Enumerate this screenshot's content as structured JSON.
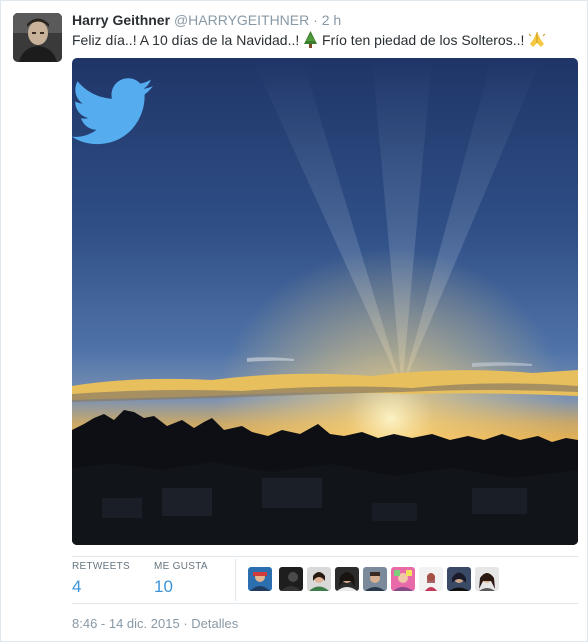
{
  "tweet": {
    "author_name": "Harry Geithner",
    "handle": "@HARRYGEITHNER",
    "separator": "·",
    "time_ago": "2 h",
    "text_part1": "Feliz día..! A 10 días de la Navidad..! ",
    "text_part2": "Frío ten piedad de los Solteros..! ",
    "emoji_1": "christmas-tree",
    "emoji_2": "folded-hands"
  },
  "media": {
    "description_icon": "twitter-bird-icon",
    "brand_color": "#55acee"
  },
  "stats": {
    "retweets_label": "RETWEETS",
    "retweets_count": "4",
    "likes_label": "ME GUSTA",
    "likes_count": "10",
    "liker_count_visible": 9
  },
  "footer": {
    "timestamp": "8:46 - 14 dic. 2015",
    "separator": "·",
    "details_label": "Detalles"
  },
  "colors": {
    "link_blue": "#3b94d9",
    "muted": "#8899a6",
    "text": "#292f33",
    "border": "#e1e8ed"
  }
}
